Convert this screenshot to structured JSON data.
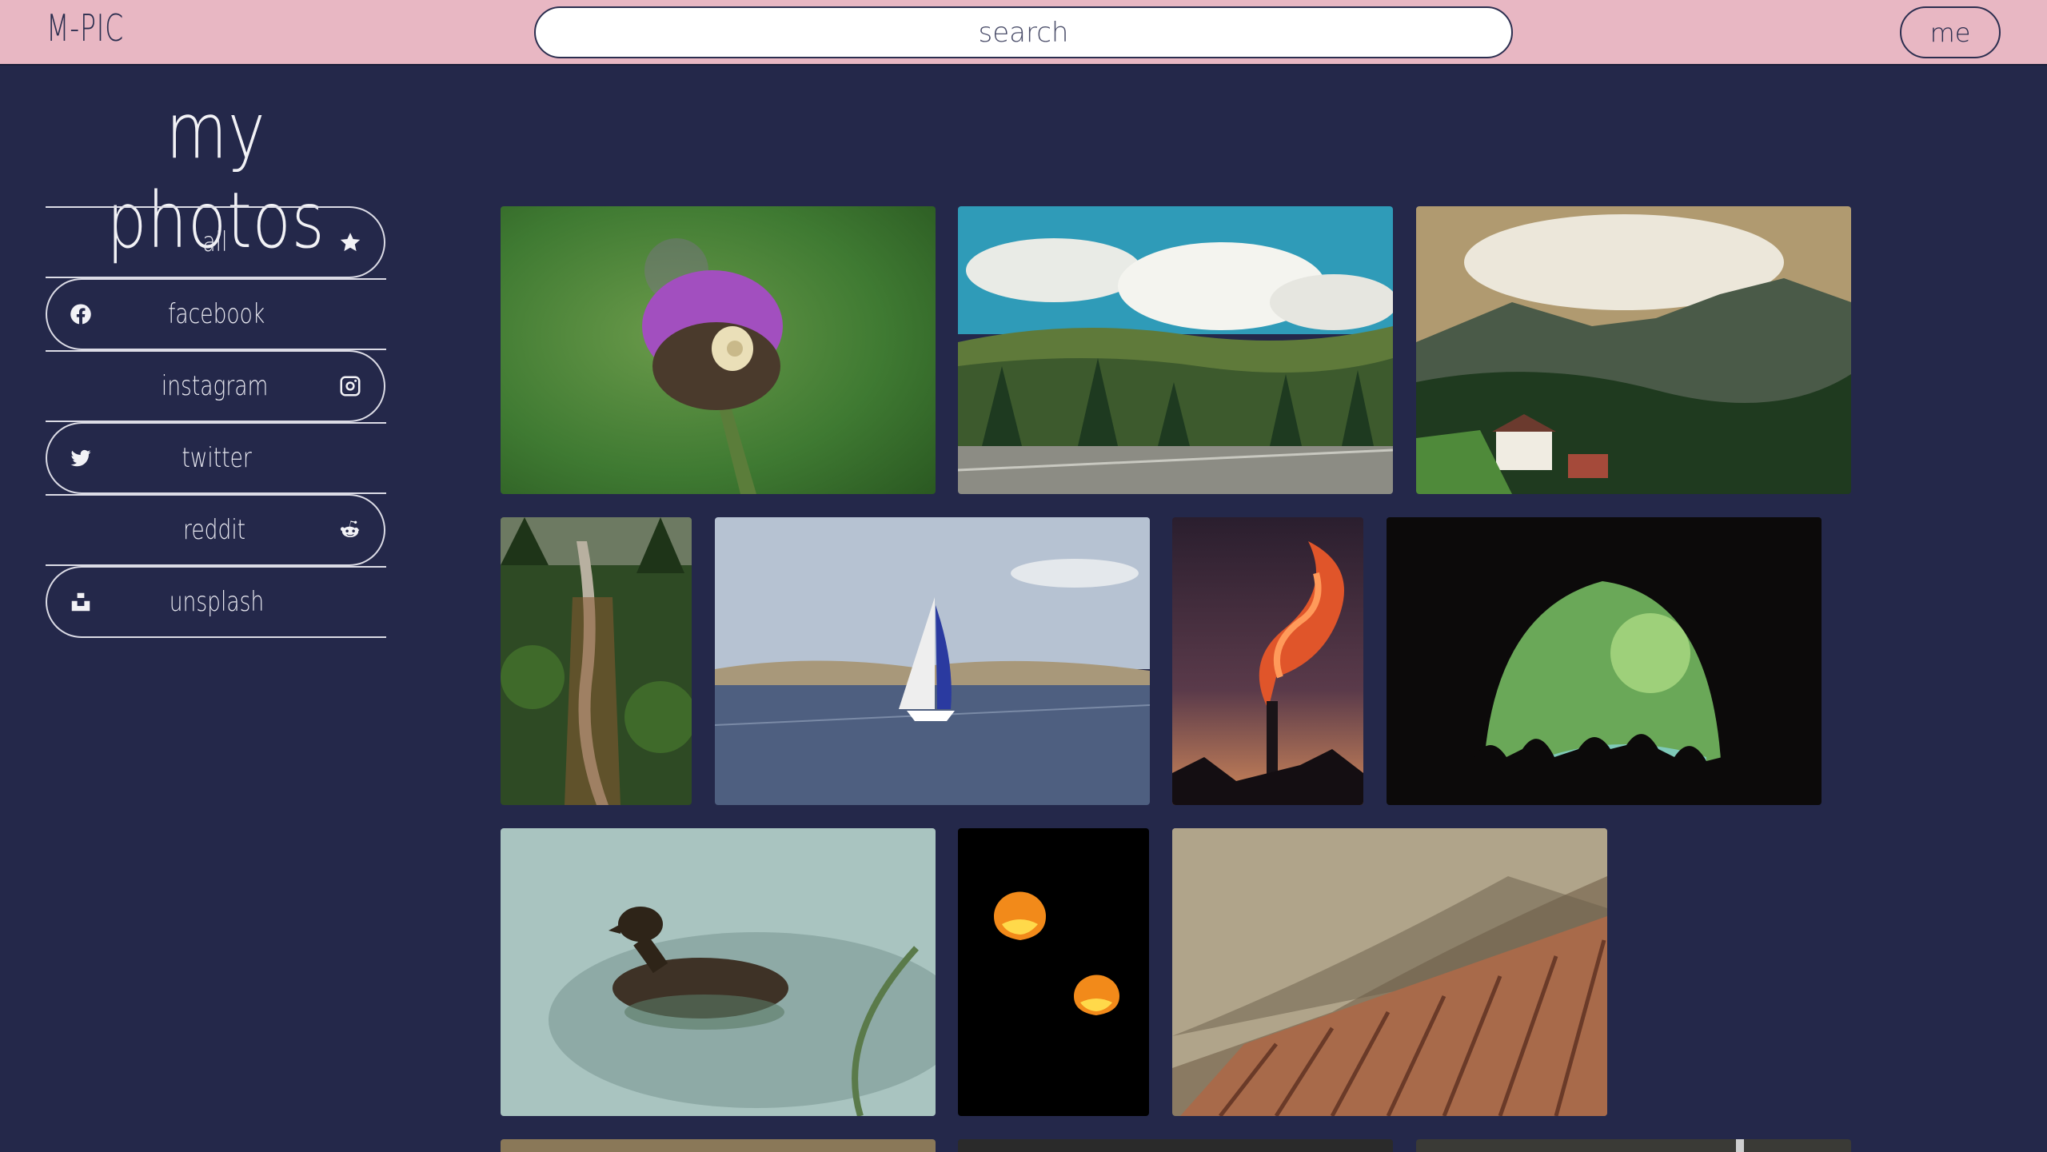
{
  "header": {
    "logo": "M-PIC",
    "search_placeholder": "search",
    "me_label": "me"
  },
  "page": {
    "title": "my photos"
  },
  "nav": {
    "items": [
      {
        "label": "all",
        "icon": "star-icon"
      },
      {
        "label": "facebook",
        "icon": "facebook-icon"
      },
      {
        "label": "instagram",
        "icon": "instagram-icon"
      },
      {
        "label": "twitter",
        "icon": "twitter-icon"
      },
      {
        "label": "reddit",
        "icon": "reddit-icon"
      },
      {
        "label": "unsplash",
        "icon": "unsplash-icon"
      }
    ]
  },
  "gallery": {
    "photos": [
      {
        "subject": "purple thistle flower with snail"
      },
      {
        "subject": "mountain landscape with clouds and road"
      },
      {
        "subject": "mountain valley with house"
      },
      {
        "subject": "waterfall in forest"
      },
      {
        "subject": "sailboat on lake"
      },
      {
        "subject": "chimney smoke at sunset"
      },
      {
        "subject": "people in cave mouth"
      },
      {
        "subject": "duck on clear water"
      },
      {
        "subject": "two glowing orange lights in darkness"
      },
      {
        "subject": "wooden deck under rock"
      },
      {
        "subject": "partial photo"
      },
      {
        "subject": "partial photo"
      },
      {
        "subject": "partial photo"
      }
    ]
  },
  "colors": {
    "topbar": "#e8b7c3",
    "background": "#24284a",
    "text_light": "#f2f2f6",
    "text_dark": "#2b2e4f"
  }
}
